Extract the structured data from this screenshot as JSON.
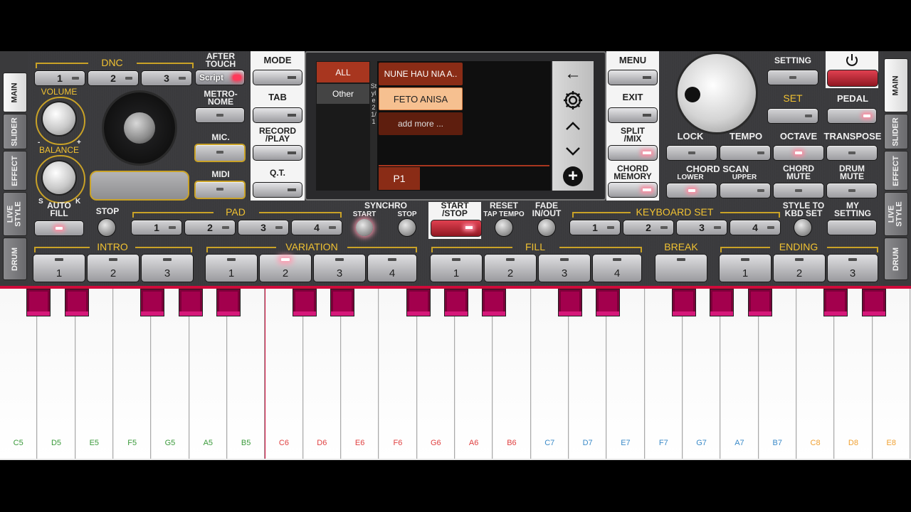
{
  "side_tabs_left": [
    "MAIN",
    "SLIDER",
    "EFFECT",
    "LIVE STYLE",
    "DRUM"
  ],
  "side_tabs_right": [
    "MAIN",
    "SLIDER",
    "EFFECT",
    "LIVE STYLE",
    "DRUM"
  ],
  "dnc": {
    "title": "DNC",
    "buttons": [
      "1",
      "2",
      "3"
    ],
    "script_label": "Script"
  },
  "after_touch": "AFTER\nTOUCH",
  "metronome": "METRO-\nNOME",
  "mic": "MIC.",
  "midi": "MIDI",
  "volume": "VOLUME",
  "balance": "BALANCE",
  "balance_ticks": {
    "minus": "-",
    "plus": "+",
    "s": "S",
    "k": "K"
  },
  "center_col": {
    "mode": "MODE",
    "tab": "TAB",
    "record": "RECORD\n/PLAY",
    "qt": "Q.T."
  },
  "screen": {
    "categories": [
      "ALL",
      "Other"
    ],
    "style_vertical": "Style 2 1/1",
    "styles": [
      "NUNE HAU NIA A..",
      "FETO ANISA",
      "add more ..."
    ],
    "selected_style": "FETO ANISA",
    "page": "P1"
  },
  "right_col": {
    "menu": "MENU",
    "exit": "EXIT",
    "split_mix": "SPLIT\n/MIX",
    "chord_memory": "CHORD\nMEMORY"
  },
  "setting": "SETTING",
  "set": "SET",
  "pedal": "PEDAL",
  "lock": "LOCK",
  "tempo": "TEMPO",
  "octave": "OCTAVE",
  "transpose": "TRANSPOSE",
  "chord_scan": {
    "title": "CHORD SCAN",
    "lower": "LOWER",
    "upper": "UPPER"
  },
  "chord_mute": "CHORD\nMUTE",
  "drum_mute": "DRUM\nMUTE",
  "auto_fill": "AUTO\nFILL",
  "stop": "STOP",
  "pad": {
    "title": "PAD",
    "buttons": [
      "1",
      "2",
      "3",
      "4"
    ]
  },
  "synchro": {
    "title": "SYNCHRO",
    "start": "START",
    "stop": "STOP"
  },
  "start_stop": "START\n/STOP",
  "reset": {
    "title": "RESET",
    "sub": "TAP TEMPO"
  },
  "fade": "FADE\nIN/OUT",
  "keyboard_set": {
    "title": "KEYBOARD SET",
    "buttons": [
      "1",
      "2",
      "3",
      "4"
    ]
  },
  "style_to_kbd": "STYLE TO\nKBD SET",
  "my_setting": "MY\nSETTING",
  "intro": {
    "title": "INTRO",
    "buttons": [
      "1",
      "2",
      "3"
    ]
  },
  "variation": {
    "title": "VARIATION",
    "buttons": [
      "1",
      "2",
      "3",
      "4"
    ],
    "active": "2"
  },
  "fill": {
    "title": "FILL",
    "buttons": [
      "1",
      "2",
      "3",
      "4"
    ]
  },
  "break": "BREAK",
  "ending": {
    "title": "ENDING",
    "buttons": [
      "1",
      "2",
      "3"
    ]
  },
  "white_keys": [
    {
      "note": "C5",
      "color": "#3a9a3a"
    },
    {
      "note": "D5",
      "color": "#3a9a3a"
    },
    {
      "note": "E5",
      "color": "#3a9a3a"
    },
    {
      "note": "F5",
      "color": "#3a9a3a"
    },
    {
      "note": "G5",
      "color": "#3a9a3a"
    },
    {
      "note": "A5",
      "color": "#3a9a3a"
    },
    {
      "note": "B5",
      "color": "#3a9a3a"
    },
    {
      "note": "C6",
      "color": "#e04040"
    },
    {
      "note": "D6",
      "color": "#e04040"
    },
    {
      "note": "E6",
      "color": "#e04040"
    },
    {
      "note": "F6",
      "color": "#e04040"
    },
    {
      "note": "G6",
      "color": "#e04040"
    },
    {
      "note": "A6",
      "color": "#e04040"
    },
    {
      "note": "B6",
      "color": "#e04040"
    },
    {
      "note": "C7",
      "color": "#3a8ac8"
    },
    {
      "note": "D7",
      "color": "#3a8ac8"
    },
    {
      "note": "E7",
      "color": "#3a8ac8"
    },
    {
      "note": "F7",
      "color": "#3a8ac8"
    },
    {
      "note": "G7",
      "color": "#3a8ac8"
    },
    {
      "note": "A7",
      "color": "#3a8ac8"
    },
    {
      "note": "B7",
      "color": "#3a8ac8"
    },
    {
      "note": "C8",
      "color": "#f0a030"
    },
    {
      "note": "D8",
      "color": "#f0a030"
    },
    {
      "note": "E8",
      "color": "#f0a030"
    }
  ],
  "colors": {
    "accent_gold": "#f1c232",
    "key_black": "#a3004d",
    "selected_style_bg": "#f6c090",
    "power_red": "#b0202a"
  },
  "icons": [
    "back-arrow-icon",
    "gear-icon",
    "chevron-up-icon",
    "chevron-down-icon",
    "plus-icon",
    "power-icon"
  ]
}
